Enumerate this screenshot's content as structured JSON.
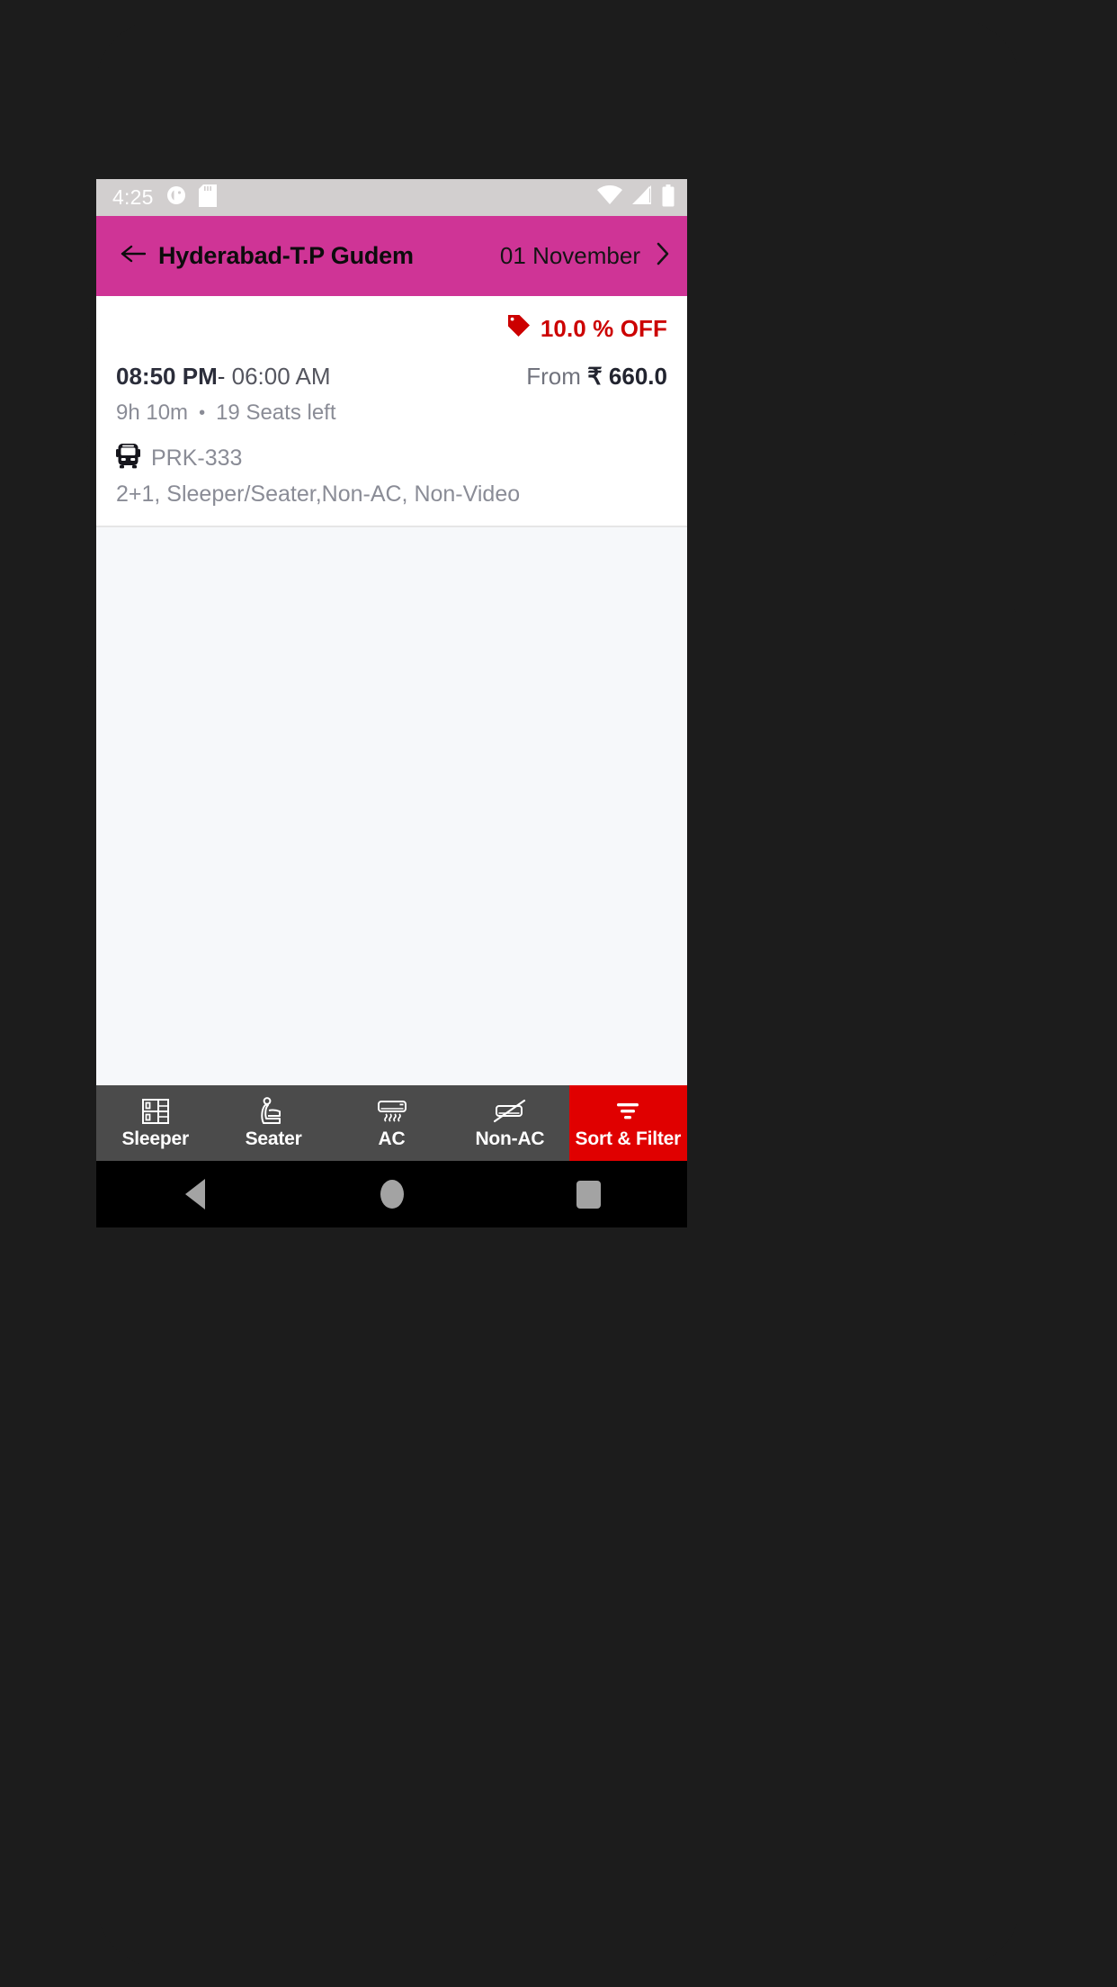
{
  "status_bar": {
    "time": "4:25",
    "left_icons": [
      "app-notification-icon",
      "sd-card-icon"
    ],
    "right_icons": [
      "wifi-icon",
      "signal-icon",
      "battery-icon"
    ],
    "background": "#d2cfcf"
  },
  "app_bar": {
    "back_icon": "back-arrow-icon",
    "route_title": "Hyderabad-T.P Gudem",
    "travel_date": "01 November",
    "next_icon": "chevron-right-icon",
    "background": "#cf3496"
  },
  "trip": {
    "offer": {
      "icon": "price-tag-icon",
      "label": "10.0 % OFF",
      "color": "#cc0000"
    },
    "departure_time": "08:50 PM",
    "time_separator": "-",
    "arrival_time": "06:00 AM",
    "price_prefix": "From",
    "price": "₹ 660.0",
    "duration": "9h 10m",
    "bullet": "•",
    "seats_left": "19 Seats left",
    "bus_icon": "bus-icon",
    "bus_number": "PRK-333",
    "features": "2+1, Sleeper/Seater,Non-AC, Non-Video"
  },
  "filter_bar": {
    "background": "#4b4b4b",
    "accent_color": "#e00000",
    "items": [
      {
        "label": "Sleeper",
        "icon": "sleeper-berth-icon",
        "accent": false
      },
      {
        "label": "Seater",
        "icon": "seat-icon",
        "accent": false
      },
      {
        "label": "AC",
        "icon": "ac-unit-icon",
        "accent": false
      },
      {
        "label": "Non-AC",
        "icon": "ac-unit-off-icon",
        "accent": false
      },
      {
        "label": "Sort & Filter",
        "icon": "filter-icon",
        "accent": true
      }
    ]
  },
  "nav_bar": {
    "back": "back-triangle-icon",
    "home": "home-circle-icon",
    "recents": "recents-square-icon"
  }
}
